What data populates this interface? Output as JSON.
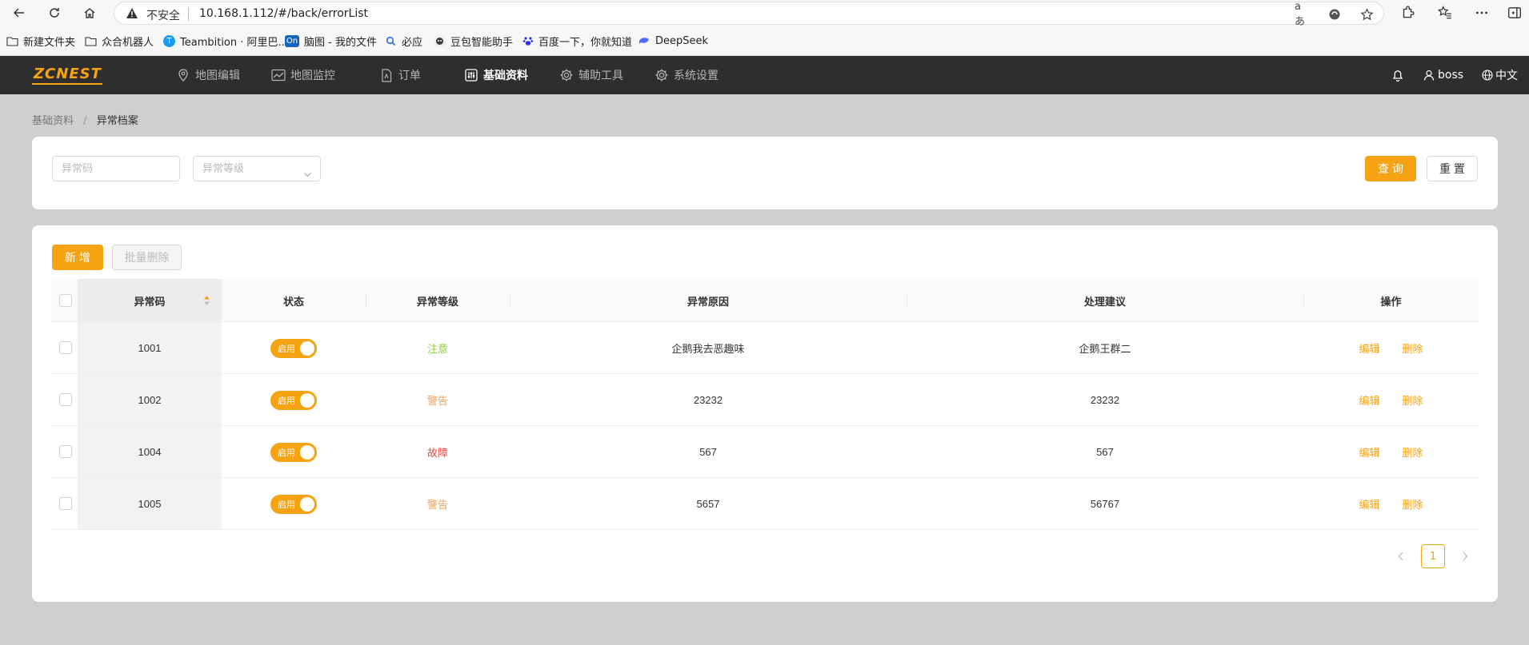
{
  "browser": {
    "insecure_label": "不安全",
    "url": "10.168.1.112/#/back/errorList",
    "read_aloud": "aあ",
    "bookmarks": [
      {
        "label": "新建文件夹",
        "icon": "folder-icon"
      },
      {
        "label": "众合机器人",
        "icon": "folder-icon"
      },
      {
        "label": "Teambition · 阿里巴...",
        "icon": "teambition-icon"
      },
      {
        "label": "脑图 - 我的文件",
        "icon": "on-icon"
      },
      {
        "label": "必应",
        "icon": "bing-search-icon"
      },
      {
        "label": "豆包智能助手",
        "icon": "doubao-icon"
      },
      {
        "label": "百度一下，你就知道",
        "icon": "baidu-paw-icon"
      },
      {
        "label": "DeepSeek",
        "icon": "deepseek-whale-icon"
      }
    ]
  },
  "header": {
    "logo": "ZCNEST",
    "menu": [
      {
        "label": "地图编辑",
        "icon": "map-pin-icon",
        "active": false
      },
      {
        "label": "地图监控",
        "icon": "chart-line-icon",
        "active": false
      },
      {
        "label": "订单",
        "icon": "document-icon",
        "active": false
      },
      {
        "label": "基础资料",
        "icon": "sliders-icon",
        "active": true
      },
      {
        "label": "辅助工具",
        "icon": "gear-icon",
        "active": false
      },
      {
        "label": "系统设置",
        "icon": "gear-icon",
        "active": false
      }
    ],
    "user": "boss",
    "language": "中文"
  },
  "breadcrumb": {
    "parent": "基础资料",
    "separator": "/",
    "current": "异常档案"
  },
  "search": {
    "code_placeholder": "异常码",
    "level_placeholder": "异常等级",
    "query_label": "查 询",
    "reset_label": "重 置"
  },
  "toolbar": {
    "add_label": "新 增",
    "batch_delete_label": "批量删除"
  },
  "table": {
    "columns": [
      "异常码",
      "状态",
      "异常等级",
      "异常原因",
      "处理建议",
      "操作"
    ],
    "rows": [
      {
        "code": "1001",
        "status": "启用",
        "level": "注意",
        "level_color": "#8fce3c",
        "reason": "企鹅我去恶趣味",
        "advice": "企鹅王群二"
      },
      {
        "code": "1002",
        "status": "启用",
        "level": "警告",
        "level_color": "#f5a25a",
        "reason": "23232",
        "advice": "23232"
      },
      {
        "code": "1004",
        "status": "启用",
        "level": "故障",
        "level_color": "#f04848",
        "reason": "567",
        "advice": "567"
      },
      {
        "code": "1005",
        "status": "启用",
        "level": "警告",
        "level_color": "#f5a25a",
        "reason": "5657",
        "advice": "56767"
      }
    ],
    "edit_label": "编辑",
    "delete_label": "删除"
  },
  "pagination": {
    "current_page": "1"
  },
  "colors": {
    "accent": "#f5a312",
    "header_bg": "#2e2e2e"
  }
}
